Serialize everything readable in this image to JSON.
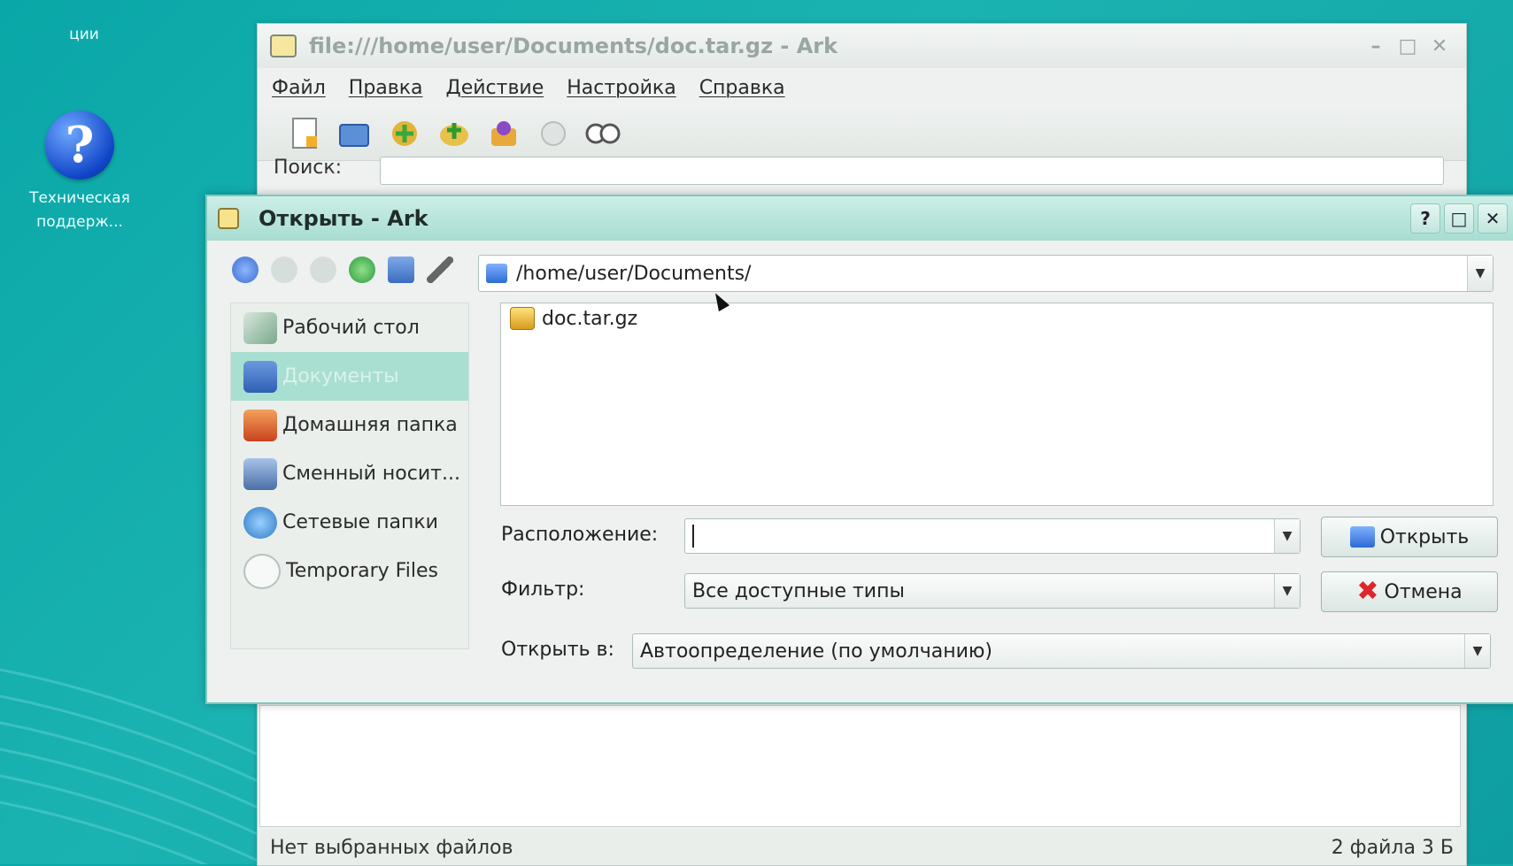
{
  "desktop": {
    "top_icon_label": "ции",
    "help_icon_label": "Техническая поддерж..."
  },
  "ark": {
    "title": "file:///home/user/Documents/doc.tar.gz - Ark",
    "menu": [
      "Файл",
      "Правка",
      "Действие",
      "Настройка",
      "Справка"
    ],
    "search_label": "Поиск:",
    "status_left": "Нет выбранных файлов",
    "status_right": "2 файла 3 Б"
  },
  "dialog": {
    "title": "Открыть - Ark",
    "path": "/home/user/Documents/",
    "places": [
      {
        "label": "Рабочий стол",
        "icon": "desktop-icon",
        "color": "#7aa88c"
      },
      {
        "label": "Документы",
        "icon": "documents-icon",
        "color": "#3e74c8",
        "selected": true
      },
      {
        "label": "Домашняя папка",
        "icon": "home-icon",
        "color": "#d85a2a"
      },
      {
        "label": "Сменный носит...",
        "icon": "removable-media-icon",
        "color": "#5a7fb5"
      },
      {
        "label": "Сетевые папки",
        "icon": "network-folders-icon",
        "color": "#3a8bd0"
      },
      {
        "label": "Temporary Files",
        "icon": "temp-files-icon",
        "color": "#cfd6d3"
      }
    ],
    "files": [
      "doc.tar.gz"
    ],
    "location_label": "Расположение:",
    "location_value": "",
    "filter_label": "Фильтр:",
    "filter_value": "Все доступные типы",
    "open_with_label": "Открыть в:",
    "open_with_value": "Автоопределение (по умолчанию)",
    "open_button": "Открыть",
    "cancel_button": "Отмена"
  }
}
